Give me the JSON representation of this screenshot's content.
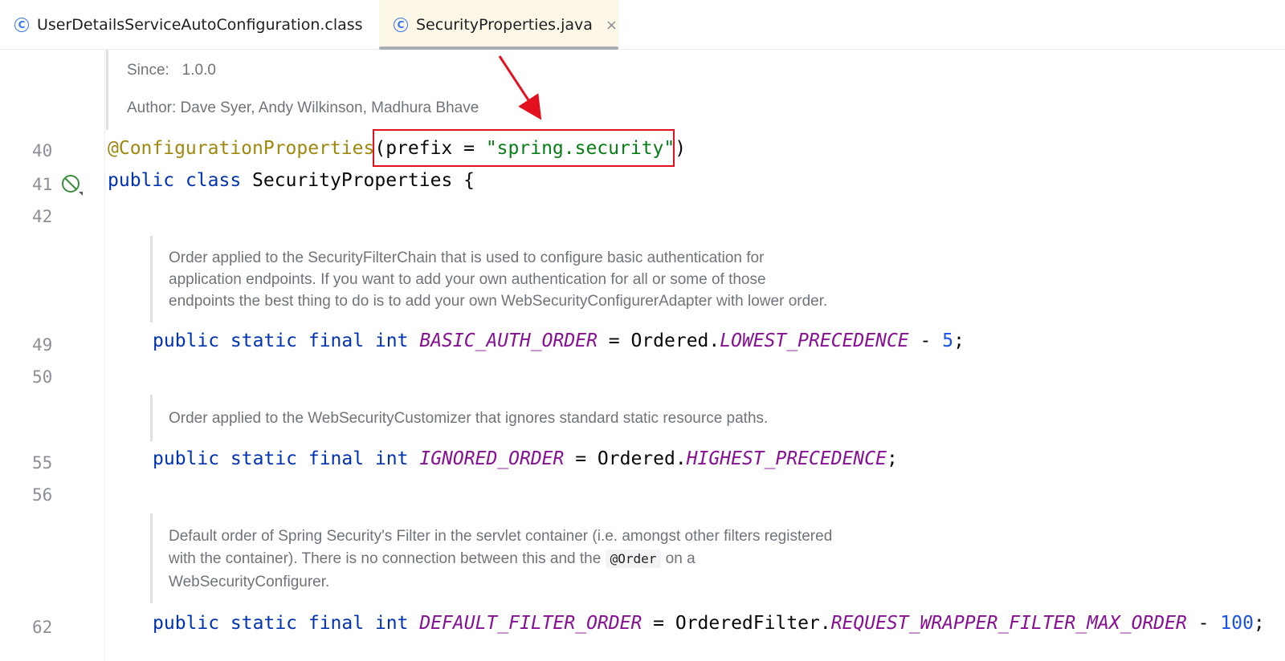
{
  "tabs": [
    {
      "label": "UserDetailsServiceAutoConfiguration.class",
      "icon": "class-icon",
      "active": false
    },
    {
      "label": "SecurityProperties.java",
      "icon": "class-icon",
      "active": true,
      "close": "×"
    }
  ],
  "tab_icon_glyph": "C",
  "doc_header": {
    "since_label": "Since:",
    "since_value": "1.0.0",
    "author": "Author: Dave Syer, Andy Wilkinson, Madhura Bhave"
  },
  "lines": {
    "l40": {
      "num": "40",
      "annotation": "@ConfigurationProperties",
      "open": "(prefix = ",
      "string": "\"spring.security\"",
      "close": ")"
    },
    "l41": {
      "num": "41",
      "kw1": "public",
      "kw2": "class",
      "name": " SecurityProperties {"
    },
    "l42": {
      "num": "42"
    },
    "l49": {
      "num": "49",
      "kws": "public static final int",
      "const": "BASIC_AUTH_ORDER",
      "mid": " = Ordered.",
      "const2": "LOWEST_PRECEDENCE",
      "op": " - ",
      "num_val": "5",
      "end": ";"
    },
    "l50": {
      "num": "50"
    },
    "l55": {
      "num": "55",
      "kws": "public static final int",
      "const": "IGNORED_ORDER",
      "mid": " = Ordered.",
      "const2": "HIGHEST_PRECEDENCE",
      "end": ";"
    },
    "l56": {
      "num": "56"
    },
    "l62": {
      "num": "62",
      "kws": "public static final int",
      "const": "DEFAULT_FILTER_ORDER",
      "mid": " = OrderedFilter.",
      "const2": "REQUEST_WRAPPER_FILTER_MAX_ORDER",
      "op": " - ",
      "num_val": "100",
      "end": ";"
    }
  },
  "docs": {
    "basic_auth": [
      "Order applied to the SecurityFilterChain that is used to configure basic authentication for",
      "application endpoints. If you want to add your own authentication for all or some of those",
      "endpoints the best thing to do is to add your own WebSecurityConfigurerAdapter with lower order."
    ],
    "ignored": "Order applied to the WebSecurityCustomizer that ignores standard static resource paths.",
    "filter": {
      "line1": "Default order of Spring Security's Filter in the servlet container (i.e. amongst other filters registered",
      "line2_pre": "with the container). There is no connection between this and the ",
      "line2_code": "@Order",
      "line2_post": " on a",
      "line3": "WebSecurityConfigurer."
    }
  },
  "colors": {
    "highlight_box": "#e3101e",
    "arrow": "#e3101e",
    "gutter_icon": "#3a8d3a"
  }
}
